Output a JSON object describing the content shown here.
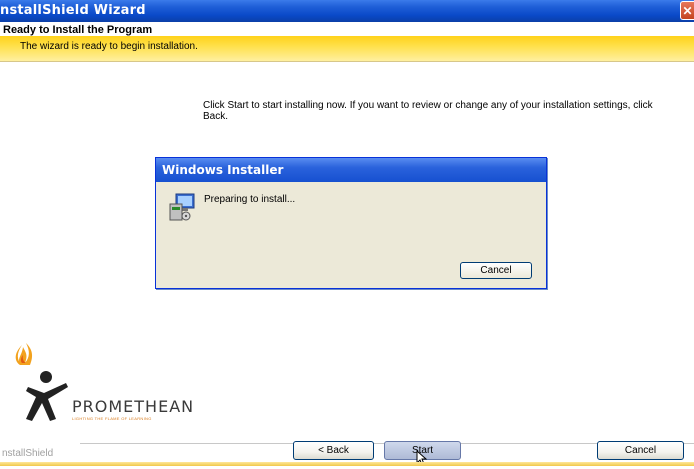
{
  "window": {
    "title": "nstallShield Wizard",
    "close_glyph": "✕"
  },
  "header": {
    "title": "Ready to Install the Program",
    "subtitle": "The wizard is ready to begin installation."
  },
  "body": {
    "text": "Click Start to start installing now. If you want to review or change any of your installation settings, click Back."
  },
  "installer_dialog": {
    "title": "Windows Installer",
    "status": "Preparing to install...",
    "cancel_label": "Cancel",
    "icon": "installer-icon"
  },
  "logo": {
    "name": "PROMETHEAN",
    "tagline": "LIGHTING THE FLAME OF LEARNING"
  },
  "footer": {
    "brand": "nstallShield",
    "back_label": "< Back",
    "start_label": "Start",
    "cancel_label": "Cancel"
  },
  "colors": {
    "titlebar": "#0a49c8",
    "header_band": "#ffd21a",
    "dialog_bg": "#ece9d8"
  }
}
